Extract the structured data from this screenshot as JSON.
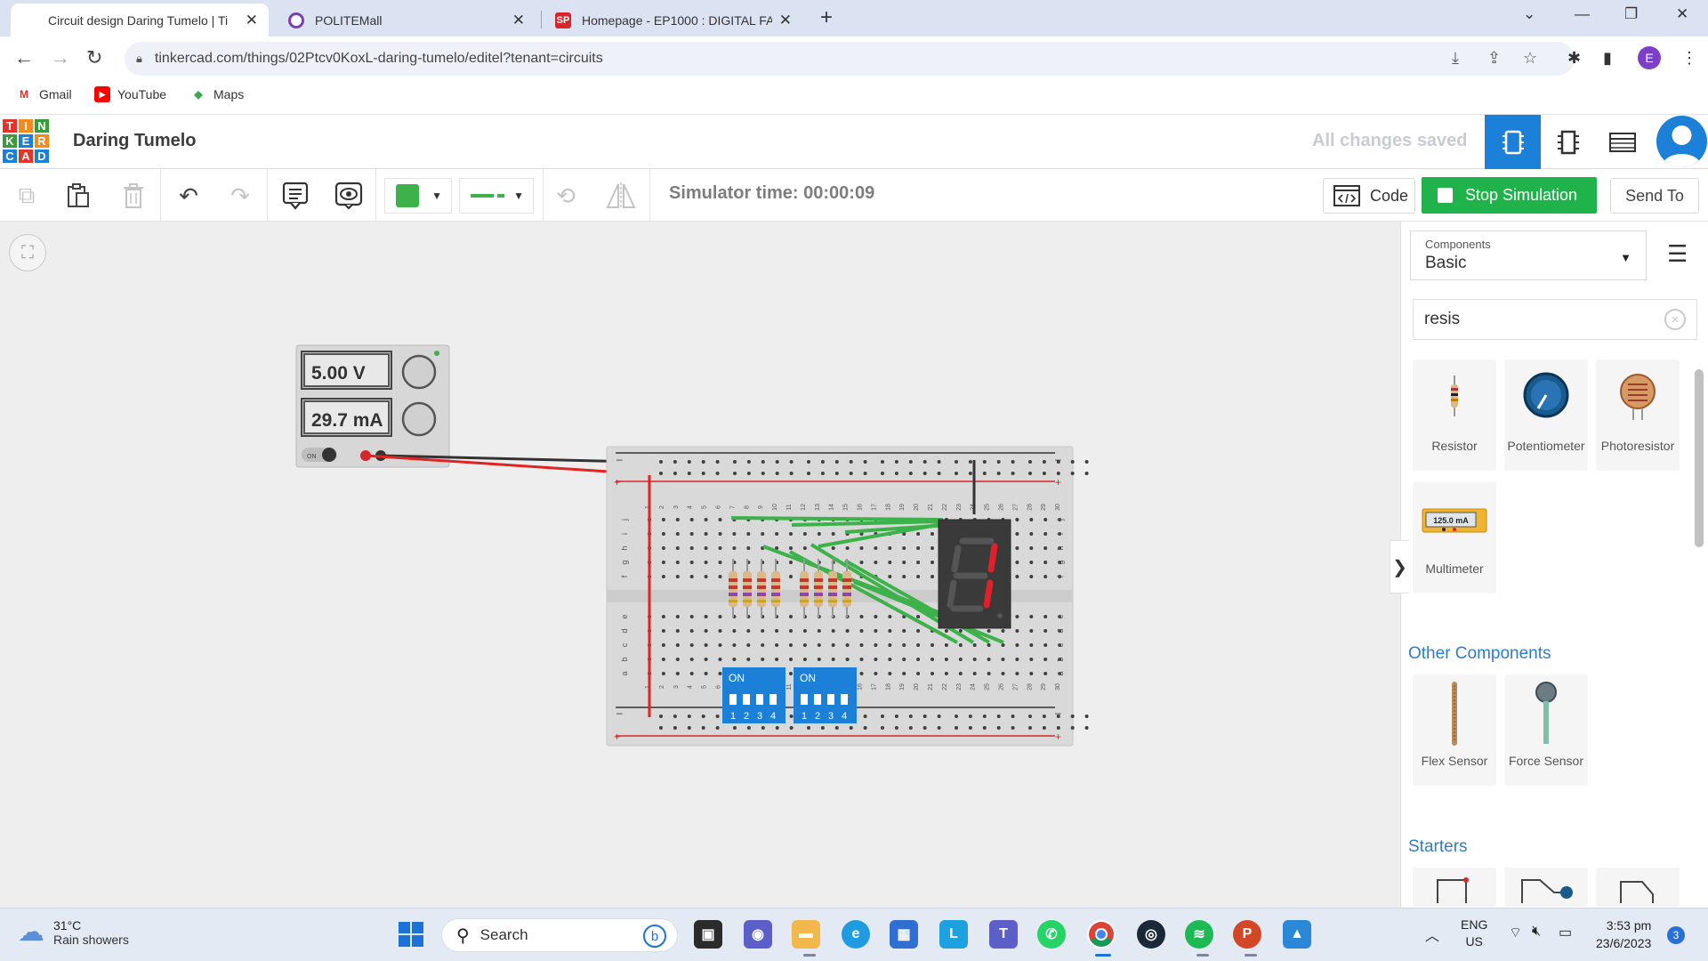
{
  "browser": {
    "tabs": [
      {
        "title": "Circuit design Daring Tumelo | Ti",
        "icon": "tinkercad-favicon"
      },
      {
        "title": "POLITEMall",
        "icon": "politemall-favicon"
      },
      {
        "title": "Homepage - EP1000 : DIGITAL FA",
        "icon": "sp-favicon",
        "icon_text": "SP"
      }
    ],
    "url": "tinkercad.com/things/02Ptcv0KoxL-daring-tumelo/editel?tenant=circuits",
    "profile_initial": "E",
    "bookmarks": [
      {
        "label": "Gmail",
        "icon": "gmail-icon",
        "icon_text": "M"
      },
      {
        "label": "YouTube",
        "icon": "youtube-icon",
        "icon_text": "▶"
      },
      {
        "label": "Maps",
        "icon": "maps-icon",
        "icon_text": "◆"
      }
    ]
  },
  "app": {
    "logo_letters": [
      "T",
      "I",
      "N",
      "K",
      "E",
      "R",
      "C",
      "A",
      "D"
    ],
    "project_title": "Daring Tumelo",
    "save_status": "All changes saved"
  },
  "toolbar": {
    "sim_time": "Simulator time: 00:00:09",
    "code_label": "Code",
    "stop_label": "Stop Simulation",
    "send_label": "Send To",
    "wire_color": "#3db14a"
  },
  "circuit": {
    "power_supply": {
      "voltage": "5.00 V",
      "current": "29.7 mA",
      "switch_label": "ON"
    },
    "breadboard": {
      "columns": [
        "1",
        "2",
        "3",
        "4",
        "5",
        "6",
        "7",
        "8",
        "9",
        "10",
        "11",
        "12",
        "13",
        "14",
        "15",
        "16",
        "17",
        "18",
        "19",
        "20",
        "21",
        "22",
        "23",
        "24",
        "25",
        "26",
        "27",
        "28",
        "29",
        "30"
      ],
      "rows_top": [
        "j",
        "i",
        "h",
        "g",
        "f"
      ],
      "rows_bottom": [
        "e",
        "d",
        "c",
        "b",
        "a"
      ],
      "rail_minus": "–",
      "rail_plus": "+"
    },
    "dip_switches": [
      {
        "label": "ON",
        "positions": [
          "1",
          "2",
          "3",
          "4"
        ]
      },
      {
        "label": "ON",
        "positions": [
          "1",
          "2",
          "3",
          "4"
        ]
      }
    ],
    "seven_segment_digit": "1"
  },
  "panel": {
    "components_label": "Components",
    "components_value": "Basic",
    "search_value": "resis",
    "results": [
      {
        "name": "Resistor",
        "icon": "resistor-icon"
      },
      {
        "name": "Potentiometer",
        "icon": "potentiometer-icon"
      },
      {
        "name": "Photoresistor",
        "icon": "photoresistor-icon"
      },
      {
        "name": "Multimeter",
        "icon": "multimeter-icon",
        "display": "125.0 mA"
      }
    ],
    "other_heading": "Other Components",
    "other": [
      {
        "name": "Flex Sensor",
        "icon": "flex-sensor-icon"
      },
      {
        "name": "Force Sensor",
        "icon": "force-sensor-icon"
      }
    ],
    "starters_heading": "Starters"
  },
  "taskbar": {
    "weather_temp": "31°C",
    "weather_desc": "Rain showers",
    "search_label": "Search",
    "lang_top": "ENG",
    "lang_bottom": "US",
    "time": "3:53 pm",
    "date": "23/6/2023",
    "notifications": "3"
  }
}
